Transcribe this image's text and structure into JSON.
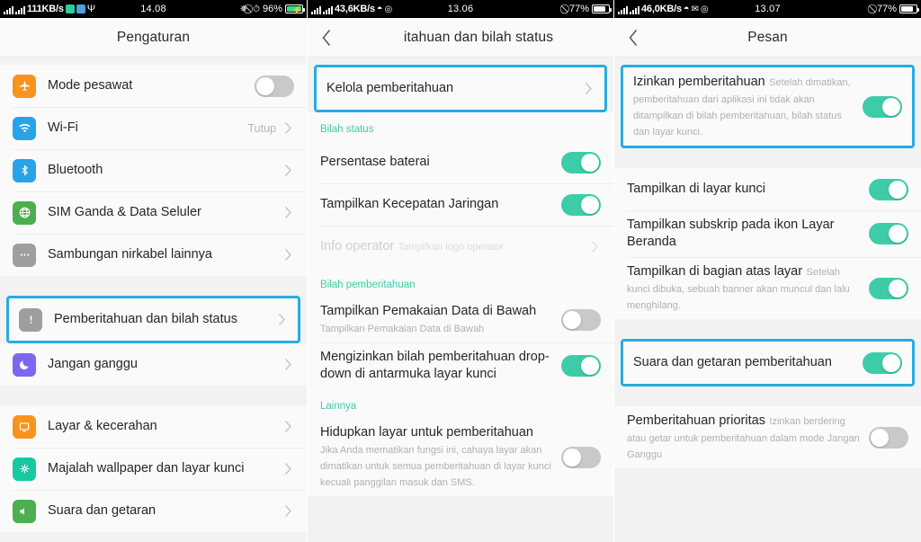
{
  "panels": [
    {
      "id": "settings",
      "statusbar": {
        "speed": "111KB/s",
        "time": "14.08",
        "battery_pct": "96%",
        "battery_state": "charging",
        "left_icons": [
          "signal-icon",
          "signal-icon",
          "app-badge-green-icon",
          "app-badge-blue-icon",
          "usb-icon"
        ],
        "right_icons": [
          "bluetooth-icon",
          "mute-icon",
          "alarm-icon"
        ]
      },
      "header": {
        "title": "Pengaturan",
        "has_back": false
      },
      "rows": [
        {
          "label": "Mode pesawat",
          "icon": "airplane-icon",
          "icon_color": "#f7941e",
          "control": "toggle-off"
        },
        {
          "label": "Wi-Fi",
          "icon": "wifi-icon",
          "icon_color": "#29a3e8",
          "value": "Tutup",
          "control": "chevron"
        },
        {
          "label": "Bluetooth",
          "icon": "bluetooth-icon",
          "icon_color": "#29a3e8",
          "control": "chevron"
        },
        {
          "label": "SIM Ganda & Data Seluler",
          "icon": "globe-icon",
          "icon_color": "#4caf50",
          "control": "chevron"
        },
        {
          "label": "Sambungan nirkabel lainnya",
          "icon": "more-icon",
          "icon_color": "#9e9e9e",
          "control": "chevron"
        },
        {
          "label": "Pemberitahuan dan bilah status",
          "icon": "alert-icon",
          "icon_color": "#9e9e9e",
          "control": "chevron",
          "highlighted": true
        },
        {
          "label": "Jangan ganggu",
          "icon": "moon-icon",
          "icon_color": "#7b68ee",
          "control": "chevron"
        },
        {
          "label": "Layar &  kecerahan",
          "icon": "display-icon",
          "icon_color": "#f7941e",
          "control": "chevron"
        },
        {
          "label": "Majalah wallpaper dan layar kunci",
          "icon": "flower-icon",
          "icon_color": "#17c9a0",
          "control": "chevron"
        },
        {
          "label": "Suara dan getaran",
          "icon": "sound-icon",
          "icon_color": "#4caf50",
          "control": "chevron",
          "clipped": true
        }
      ]
    },
    {
      "id": "notifications-and-status-bar",
      "statusbar": {
        "speed": "43,6KB/s",
        "time": "13.06",
        "battery_pct": "77%",
        "battery_state": "plain",
        "left_icons": [
          "signal-icon",
          "signal-icon",
          "wifi-icon",
          "target-icon"
        ],
        "right_icons": [
          "mute-icon"
        ]
      },
      "header": {
        "title": "itahuan dan bilah status",
        "has_back": true
      },
      "highlight_top": {
        "label": "Kelola pemberitahuan",
        "control": "chevron"
      },
      "sections": [
        {
          "title": "Bilah status",
          "rows": [
            {
              "label": "Persentase baterai",
              "control": "toggle-on"
            },
            {
              "label": "Tampilkan Kecepatan Jaringan",
              "control": "toggle-on"
            },
            {
              "label": "Info operator",
              "sub": "Tampilkan logo operator",
              "control": "chevron",
              "disabled": true
            }
          ]
        },
        {
          "title": "Bilah pemberitahuan",
          "rows": [
            {
              "label": "Tampilkan Pemakaian Data di Bawah",
              "sub": "Tampilkan Pemakaian Data di Bawah",
              "control": "toggle-off"
            },
            {
              "label": "Mengizinkan bilah pemberitahuan drop-down di antarmuka layar kunci",
              "control": "toggle-on"
            }
          ]
        },
        {
          "title": "Lainnya",
          "rows": [
            {
              "label": "Hidupkan layar untuk pemberitahuan",
              "sub": "Jika Anda mematikan fungsi ini, cahaya layar akan dimatikan untuk semua pemberitahuan di layar kunci kecuali panggilan masuk dan SMS.",
              "control": "toggle-off"
            }
          ]
        }
      ]
    },
    {
      "id": "pesan",
      "statusbar": {
        "speed": "46,0KB/s",
        "time": "13.07",
        "battery_pct": "77%",
        "battery_state": "plain",
        "left_icons": [
          "signal-icon",
          "signal-icon",
          "wifi-icon",
          "whatsapp-icon",
          "target-icon"
        ],
        "right_icons": [
          "mute-icon"
        ]
      },
      "header": {
        "title": "Pesan",
        "has_back": true
      },
      "highlight_top": {
        "label": "Izinkan pemberitahuan",
        "sub": "Setelah dimatikan, pemberitahuan dari aplikasi ini tidak akan ditampilkan di bilah pemberitahuan, bilah status dan layar kunci.",
        "control": "toggle-on"
      },
      "rows": [
        {
          "label": "Tampilkan di layar kunci",
          "control": "toggle-on"
        },
        {
          "label": "Tampilkan subskrip pada ikon Layar Beranda",
          "control": "toggle-on"
        },
        {
          "label": "Tampilkan di bagian atas layar",
          "sub": "Setelah kunci dibuka, sebuah banner akan muncul dan lalu menghilang.",
          "control": "toggle-on"
        }
      ],
      "highlight_mid": {
        "label": "Suara dan getaran pemberitahuan",
        "control": "toggle-on"
      },
      "rows_bottom": [
        {
          "label": "Pemberitahuan prioritas",
          "sub": "Izinkan berdering atau getar untuk pemberitahuan dalam mode Jangan Ganggu",
          "control": "toggle-off"
        }
      ]
    }
  ],
  "colors": {
    "accent_green": "#3ecca8",
    "highlight_cyan": "#29abe2",
    "section_header": "#3ecca8"
  }
}
